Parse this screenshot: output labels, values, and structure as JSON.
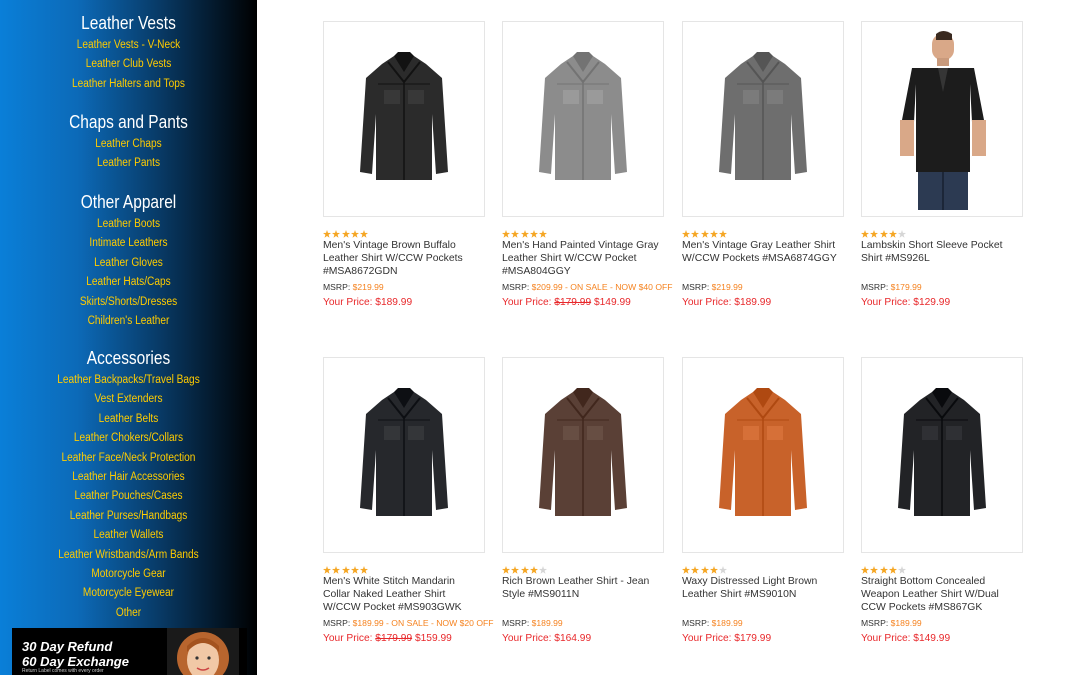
{
  "sidebar": {
    "categories": [
      {
        "title": "Leather Vests",
        "links": [
          "Leather Vests - V-Neck",
          "Leather Club Vests",
          "Leather Halters and Tops"
        ]
      },
      {
        "title": "Chaps and Pants",
        "links": [
          "Leather Chaps",
          "Leather Pants"
        ]
      },
      {
        "title": "Other Apparel",
        "links": [
          "Leather Boots",
          "Intimate Leathers",
          "Leather Gloves",
          "Leather Hats/Caps",
          "Skirts/Shorts/Dresses",
          "Children's Leather"
        ]
      },
      {
        "title": "Accessories",
        "links": [
          "Leather Backpacks/Travel Bags",
          "Vest Extenders",
          "Leather Belts",
          "Leather Chokers/Collars",
          "Leather Face/Neck Protection",
          "Leather Hair Accessories",
          "Leather Pouches/Cases",
          "Leather Purses/Handbags",
          "Leather Wallets",
          "Leather Wristbands/Arm Bands",
          "Motorcycle Gear",
          "Motorcycle Eyewear",
          "Other"
        ]
      }
    ],
    "promo": {
      "line1": "30 Day Refund",
      "line2": "60 Day Exchange",
      "small": "Return Label comes with every order"
    }
  },
  "products": [
    {
      "name": "Men's Vintage Brown Buffalo Leather Shirt W/CCW Pockets #MSA8672GDN",
      "rating": 5,
      "msrp_label": "MSRP:",
      "msrp": "$219.99",
      "price_label": "Your Price:",
      "old_price": "",
      "price": "$189.99",
      "color": "#2b2b2b",
      "model": false
    },
    {
      "name": "Men's Hand Painted Vintage Gray Leather Shirt W/CCW Pocket #MSA804GGY",
      "rating": 5,
      "msrp_label": "MSRP:",
      "msrp": "$209.99 - ON SALE - NOW $40 OFF",
      "price_label": "Your Price:",
      "old_price": "$179.99",
      "price": "$149.99",
      "color": "#8c8c8c",
      "model": false
    },
    {
      "name": "Men's Vintage Gray Leather Shirt W/CCW Pockets #MSA6874GGY",
      "rating": 5,
      "msrp_label": "MSRP:",
      "msrp": "$219.99",
      "price_label": "Your Price:",
      "old_price": "",
      "price": "$189.99",
      "color": "#6e6e6e",
      "model": false
    },
    {
      "name": "Lambskin Short Sleeve Pocket Shirt #MS926L",
      "rating": 4,
      "msrp_label": "MSRP:",
      "msrp": "$179.99",
      "price_label": "Your Price:",
      "old_price": "",
      "price": "$129.99",
      "color": "#1c1c1c",
      "model": true
    },
    {
      "name": "Men's White Stitch Mandarin Collar Naked Leather Shirt W/CCW Pocket #MS903GWK",
      "rating": 5,
      "msrp_label": "MSRP:",
      "msrp": "$189.99 - ON SALE - NOW $20 OFF",
      "price_label": "Your Price:",
      "old_price": "$179.99",
      "price": "$159.99",
      "color": "#26282c",
      "model": false
    },
    {
      "name": "Rich Brown Leather Shirt - Jean Style #MS9011N",
      "rating": 4,
      "msrp_label": "MSRP:",
      "msrp": "$189.99",
      "price_label": "Your Price:",
      "old_price": "",
      "price": "$164.99",
      "color": "#5a4036",
      "model": false
    },
    {
      "name": "Waxy Distressed Light Brown Leather Shirt #MS9010N",
      "rating": 4,
      "msrp_label": "MSRP:",
      "msrp": "$189.99",
      "price_label": "Your Price:",
      "old_price": "",
      "price": "$179.99",
      "color": "#c8622a",
      "model": false
    },
    {
      "name": "Straight Bottom Concealed Weapon Leather Shirt W/Dual CCW Pockets #MS867GK",
      "rating": 4,
      "msrp_label": "MSRP:",
      "msrp": "$189.99",
      "price_label": "Your Price:",
      "old_price": "",
      "price": "$149.99",
      "color": "#222326",
      "model": false
    }
  ],
  "colors": {
    "star_on": "#f5a623",
    "star_off": "#d6d6d6",
    "msrp": "#f5821f",
    "price": "#e8282b",
    "link": "#ffcc00"
  }
}
